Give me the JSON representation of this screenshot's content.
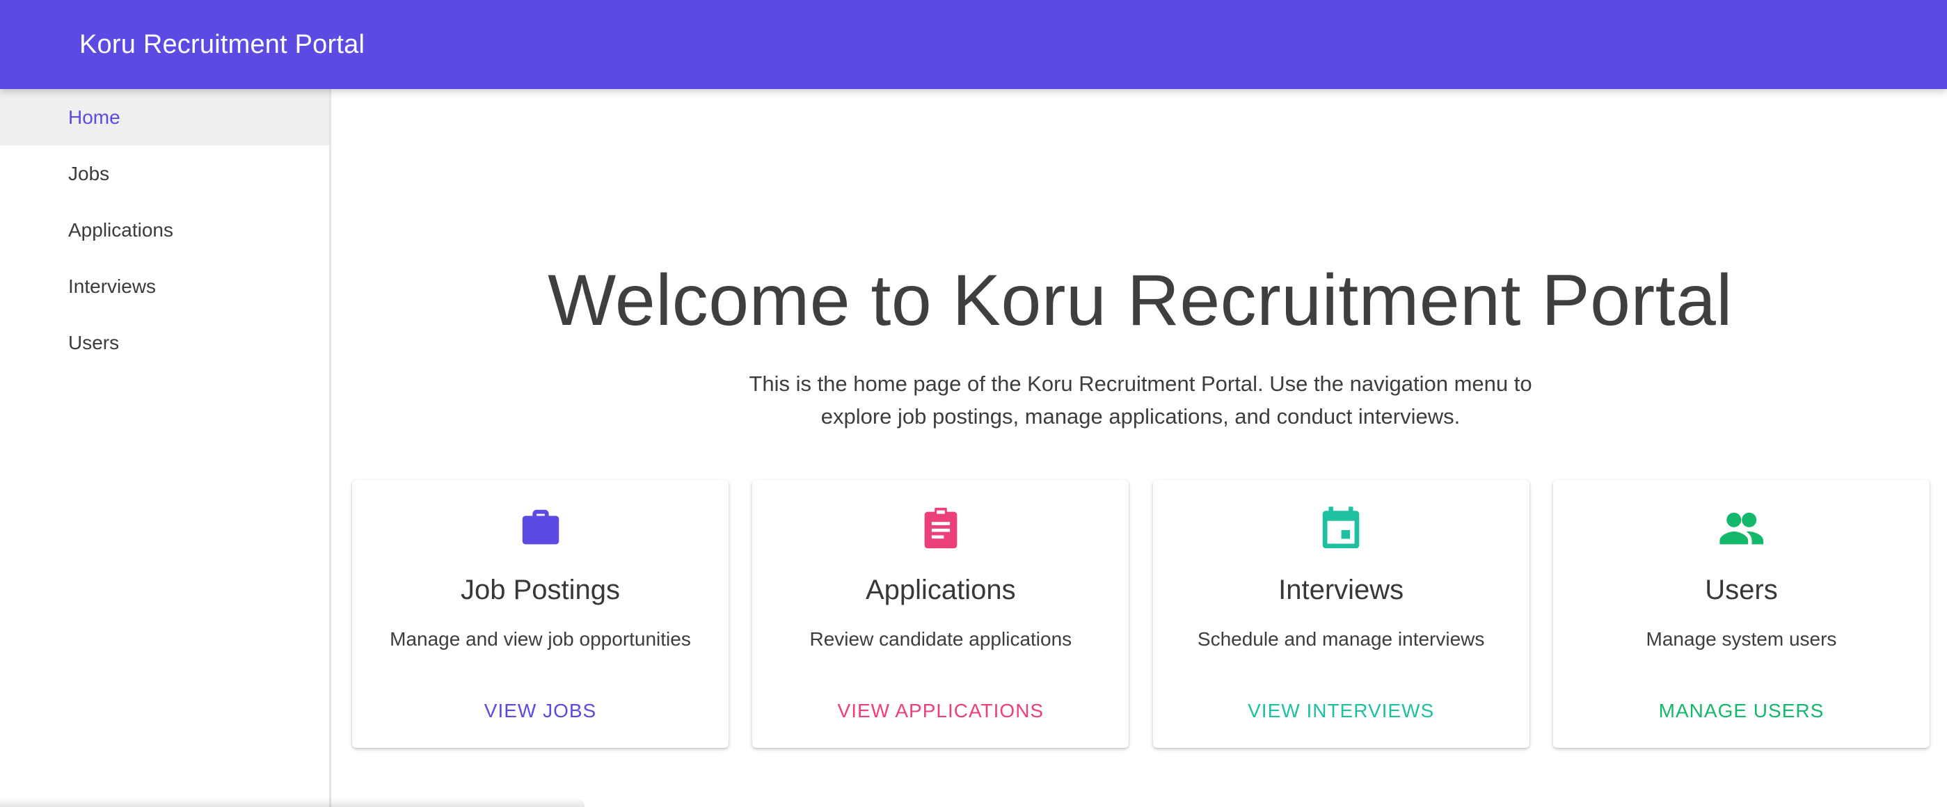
{
  "appbar": {
    "title": "Koru Recruitment Portal"
  },
  "nav": {
    "items": [
      {
        "label": "Home",
        "active": true
      },
      {
        "label": "Jobs",
        "active": false
      },
      {
        "label": "Applications",
        "active": false
      },
      {
        "label": "Interviews",
        "active": false
      },
      {
        "label": "Users",
        "active": false
      }
    ]
  },
  "hero": {
    "title": "Welcome to Koru Recruitment Portal",
    "subtitle": "This is the home page of the Koru Recruitment Portal. Use the navigation menu to explore job postings, manage applications, and conduct interviews."
  },
  "cards": [
    {
      "icon": "briefcase-icon",
      "title": "Job Postings",
      "description": "Manage and view job opportunities",
      "action": "VIEW JOBS",
      "color": "#5b4be2"
    },
    {
      "icon": "clipboard-icon",
      "title": "Applications",
      "description": "Review candidate applications",
      "action": "VIEW APPLICATIONS",
      "color": "#ec407a"
    },
    {
      "icon": "calendar-icon",
      "title": "Interviews",
      "description": "Schedule and manage interviews",
      "action": "VIEW INTERVIEWS",
      "color": "#1fc0a0"
    },
    {
      "icon": "people-icon",
      "title": "Users",
      "description": "Manage system users",
      "action": "MANAGE USERS",
      "color": "#14b86a"
    }
  ],
  "colors": {
    "primary": "#5b4be2",
    "nav_active_bg": "#efefef"
  }
}
